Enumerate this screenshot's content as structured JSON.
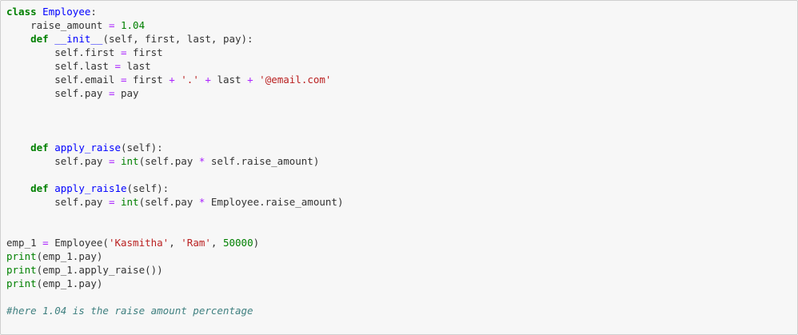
{
  "code_lines": [
    "class Employee:",
    "    raise_amount = 1.04",
    "    def __init__(self, first, last, pay):",
    "        self.first = first",
    "        self.last = last",
    "        self.email = first + '.' + last + '@email.com'",
    "        self.pay = pay",
    "",
    "",
    "",
    "    def apply_raise(self):",
    "        self.pay = int(self.pay * self.raise_amount)",
    "",
    "    def apply_rais1e(self):",
    "        self.pay = int(self.pay * Employee.raise_amount)",
    "",
    "",
    "emp_1 = Employee('Kasmitha', 'Ram', 50000)",
    "print(emp_1.pay)",
    "print(emp_1.apply_raise())",
    "print(emp_1.pay)",
    "",
    "#here 1.04 is the raise amount percentage"
  ],
  "colors": {
    "keyword": "#008000",
    "string": "#ba2121",
    "comment": "#408080",
    "operator": "#aa22ff",
    "cell_background": "#f7f7f7",
    "cell_border": "#cfcfcf"
  }
}
